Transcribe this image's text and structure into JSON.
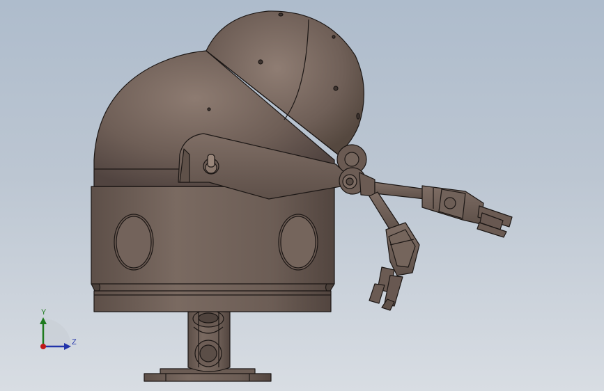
{
  "viewport": {
    "background_top": "#aebccc",
    "background_bottom": "#d8dde3",
    "model_color": "#6f5f57"
  },
  "triad": {
    "y_label": "Y",
    "z_label": "Z",
    "y_color": "#1e7a1e",
    "z_color": "#2233aa",
    "x_color": "#c01818"
  }
}
